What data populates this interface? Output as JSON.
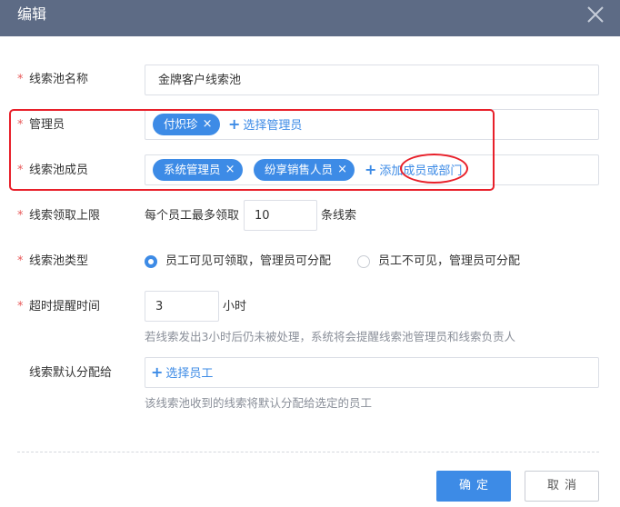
{
  "dialog": {
    "title": "编辑",
    "close_icon": "close-icon"
  },
  "form": {
    "pool_name": {
      "label": "线索池名称",
      "required": true,
      "value": "金牌客户线索池"
    },
    "admins": {
      "label": "管理员",
      "required": true,
      "tags": [
        "付炽珍"
      ],
      "add_label": "选择管理员"
    },
    "members": {
      "label": "线索池成员",
      "required": true,
      "tags": [
        "系统管理员",
        "纷享销售人员"
      ],
      "add_label": "添加成员或部门"
    },
    "limit": {
      "label": "线索领取上限",
      "required": true,
      "prefix": "每个员工最多领取",
      "value": "10",
      "suffix": "条线索"
    },
    "pool_type": {
      "label": "线索池类型",
      "required": true,
      "options": [
        "员工可见可领取，管理员可分配",
        "员工不可见，管理员可分配"
      ],
      "selected_index": 0
    },
    "timeout": {
      "label": "超时提醒时间",
      "required": true,
      "value": "3",
      "unit": "小时",
      "hint": "若线索发出3小时后仍未被处理，系统将会提醒线索池管理员和线索负责人"
    },
    "default_assign": {
      "label": "线索默认分配给",
      "required": false,
      "add_label": "选择员工",
      "hint": "该线索池收到的线索将默认分配给选定的员工"
    }
  },
  "buttons": {
    "confirm": "确定",
    "cancel": "取消"
  },
  "colors": {
    "header": "#5d6b85",
    "accent": "#3d8be6",
    "required": "#e85a5a",
    "annotation": "#e8202a"
  }
}
